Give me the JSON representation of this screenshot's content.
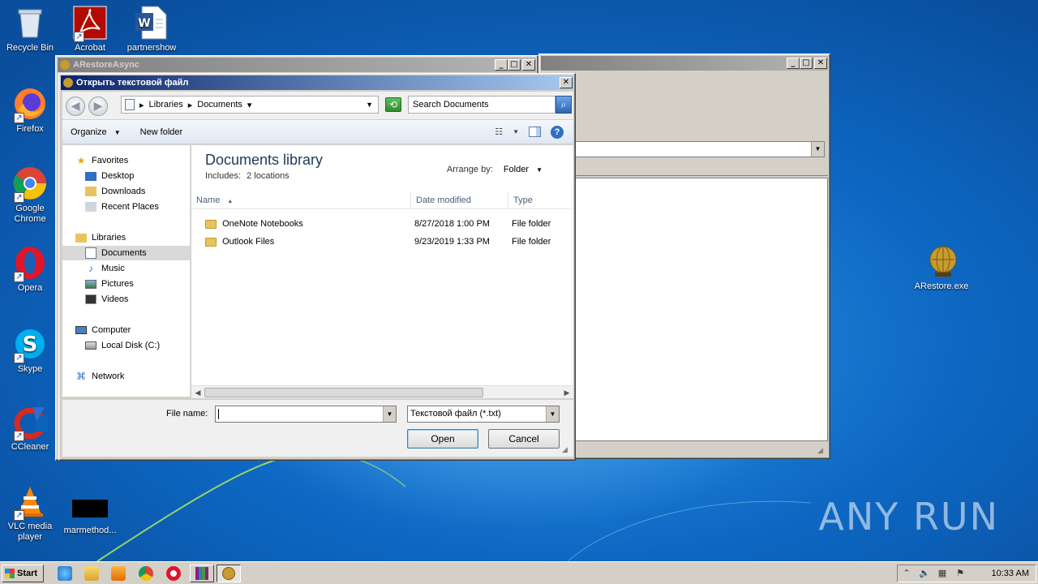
{
  "desktop": {
    "icons": [
      {
        "label": "Recycle Bin",
        "icon": "recycle-bin-icon"
      },
      {
        "label": "Acrobat",
        "icon": "acrobat-icon"
      },
      {
        "label": "partnershow",
        "icon": "word-doc-icon"
      },
      {
        "label": "Firefox",
        "icon": "firefox-icon"
      },
      {
        "label": "Google Chrome",
        "icon": "chrome-icon"
      },
      {
        "label": "Opera",
        "icon": "opera-icon"
      },
      {
        "label": "Skype",
        "icon": "skype-icon"
      },
      {
        "label": "CCleaner",
        "icon": "ccleaner-icon"
      },
      {
        "label": "VLC media player",
        "icon": "vlc-icon"
      },
      {
        "label": "marmethod...",
        "icon": "black-file-icon"
      },
      {
        "label": "ARestore.exe",
        "icon": "arestore-globe-icon"
      }
    ],
    "watermark": "ANY RUN"
  },
  "main_window": {
    "title": "ARestoreAsync",
    "minimize": "_",
    "maximize": "□",
    "close": "✕"
  },
  "second_window": {
    "minimize": "_",
    "maximize": "□",
    "close": "✕"
  },
  "dialog": {
    "title": "Открыть текстовой файл",
    "close": "✕",
    "breadcrumb": [
      "Libraries",
      "Documents"
    ],
    "search_placeholder": "Search Documents",
    "organize_label": "Organize",
    "new_folder_label": "New folder",
    "nav": {
      "favorites": "Favorites",
      "desktop": "Desktop",
      "downloads": "Downloads",
      "recent_places": "Recent Places",
      "libraries": "Libraries",
      "documents": "Documents",
      "music": "Music",
      "pictures": "Pictures",
      "videos": "Videos",
      "computer": "Computer",
      "local_disk": "Local Disk (C:)",
      "network": "Network"
    },
    "library_title": "Documents library",
    "library_includes_label": "Includes:",
    "library_includes_link": "2 locations",
    "arrange_by_label": "Arrange by:",
    "arrange_by_value": "Folder",
    "columns": {
      "name": "Name",
      "date": "Date modified",
      "type": "Type"
    },
    "files": [
      {
        "name": "OneNote Notebooks",
        "date": "8/27/2018 1:00 PM",
        "type": "File folder"
      },
      {
        "name": "Outlook Files",
        "date": "9/23/2019 1:33 PM",
        "type": "File folder"
      }
    ],
    "file_name_label": "File name:",
    "file_name_value": "",
    "file_type_value": "Текстовой файл (*.txt)",
    "open_label": "Open",
    "cancel_label": "Cancel"
  },
  "taskbar": {
    "start_label": "Start",
    "clock": "10:33 AM"
  }
}
